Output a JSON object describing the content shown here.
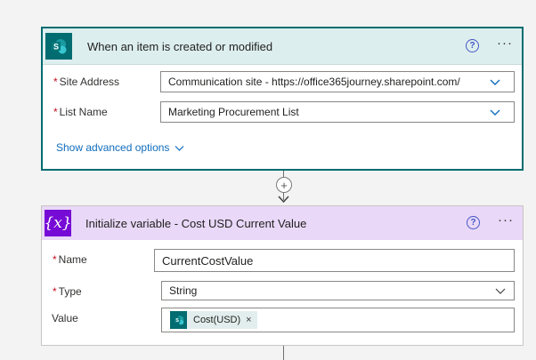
{
  "trigger": {
    "title": "When an item is created or modified",
    "icon": "sharepoint-icon",
    "fields": [
      {
        "label": "Site Address",
        "required": "*",
        "value": "Communication site - https://office365journey.sharepoint.com/"
      },
      {
        "label": "List Name",
        "required": "*",
        "value": "Marketing Procurement List"
      }
    ],
    "advanced_label": "Show advanced options"
  },
  "connector": {
    "plus_glyph": "+"
  },
  "action": {
    "title": "Initialize variable - Cost USD Current Value",
    "icon_glyph": "{x}",
    "fields": [
      {
        "label": "Name",
        "required": "*",
        "value": "CurrentCostValue"
      },
      {
        "label": "Type",
        "required": "*",
        "value": "String"
      },
      {
        "label": "Value",
        "token": {
          "label": "Cost(USD)",
          "remove": "×"
        }
      }
    ]
  },
  "common": {
    "help_glyph": "?",
    "more_glyph": "···"
  },
  "colors": {
    "sharepoint": "#036c70",
    "variable": "#770bd6",
    "link": "#0f6cbd",
    "required": "#c50f1f"
  }
}
